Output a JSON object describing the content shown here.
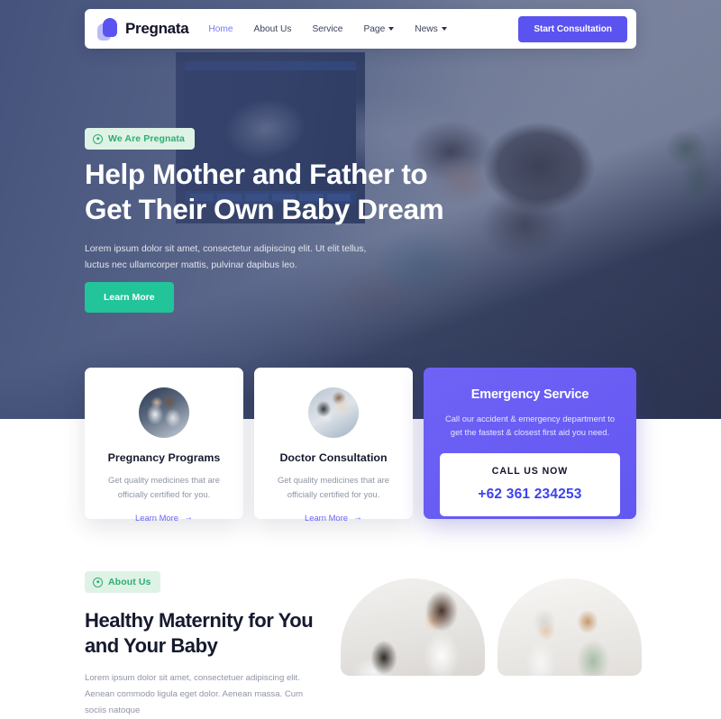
{
  "navbar": {
    "brand": "Pregnata",
    "logo_icon": "pregnata-logo-icon",
    "links": [
      {
        "label": "Home",
        "active": true,
        "caret": false
      },
      {
        "label": "About Us",
        "active": false,
        "caret": false
      },
      {
        "label": "Service",
        "active": false,
        "caret": false
      },
      {
        "label": "Page",
        "active": false,
        "caret": true
      },
      {
        "label": "News",
        "active": false,
        "caret": true
      }
    ],
    "cta_label": "Start Consultation"
  },
  "hero": {
    "badge": "We Are Pregnata",
    "badge_icon": "circle-dot-icon",
    "title": "Help Mother and Father to Get Their Own Baby Dream",
    "subtitle": "Lorem ipsum dolor sit amet, consectetur adipiscing elit. Ut elit tellus, luctus nec ullamcorper mattis, pulvinar dapibus leo.",
    "button_label": "Learn More"
  },
  "cards": [
    {
      "title": "Pregnancy Programs",
      "desc": "Get quality medicines that are officially certified for you.",
      "link_label": "Learn More",
      "link_arrow": "→",
      "avatar_icon": "pregnancy-programs-photo"
    },
    {
      "title": "Doctor Consultation",
      "desc": "Get quality medicines that are officially certified for you.",
      "link_label": "Learn More",
      "link_arrow": "→",
      "avatar_icon": "doctor-consultation-photo"
    }
  ],
  "emergency": {
    "title": "Emergency Service",
    "desc": "Call our accident & emergency department to get the fastest & closest first aid you need.",
    "call_label": "CALL US NOW",
    "phone": "+62 361 234253"
  },
  "about": {
    "badge": "About Us",
    "badge_icon": "circle-dot-icon",
    "title": "Healthy Maternity for You and Your Baby",
    "desc": "Lorem ipsum dolor sit amet, consectetuer adipiscing elit. Aenean commodo ligula eget dolor. Aenean massa. Cum sociis natoque",
    "photos": [
      {
        "icon": "doctor-examining-pregnant-woman-photo"
      },
      {
        "icon": "doctor-with-pregnant-patient-photo"
      }
    ]
  },
  "colors": {
    "brand_purple": "#5b53f0",
    "accent_green": "#22c49a",
    "badge_green_bg": "#dff2e6",
    "badge_green_text": "#2eae72",
    "phone_blue": "#3b43ef",
    "hero_overlay": "#3a4874"
  }
}
